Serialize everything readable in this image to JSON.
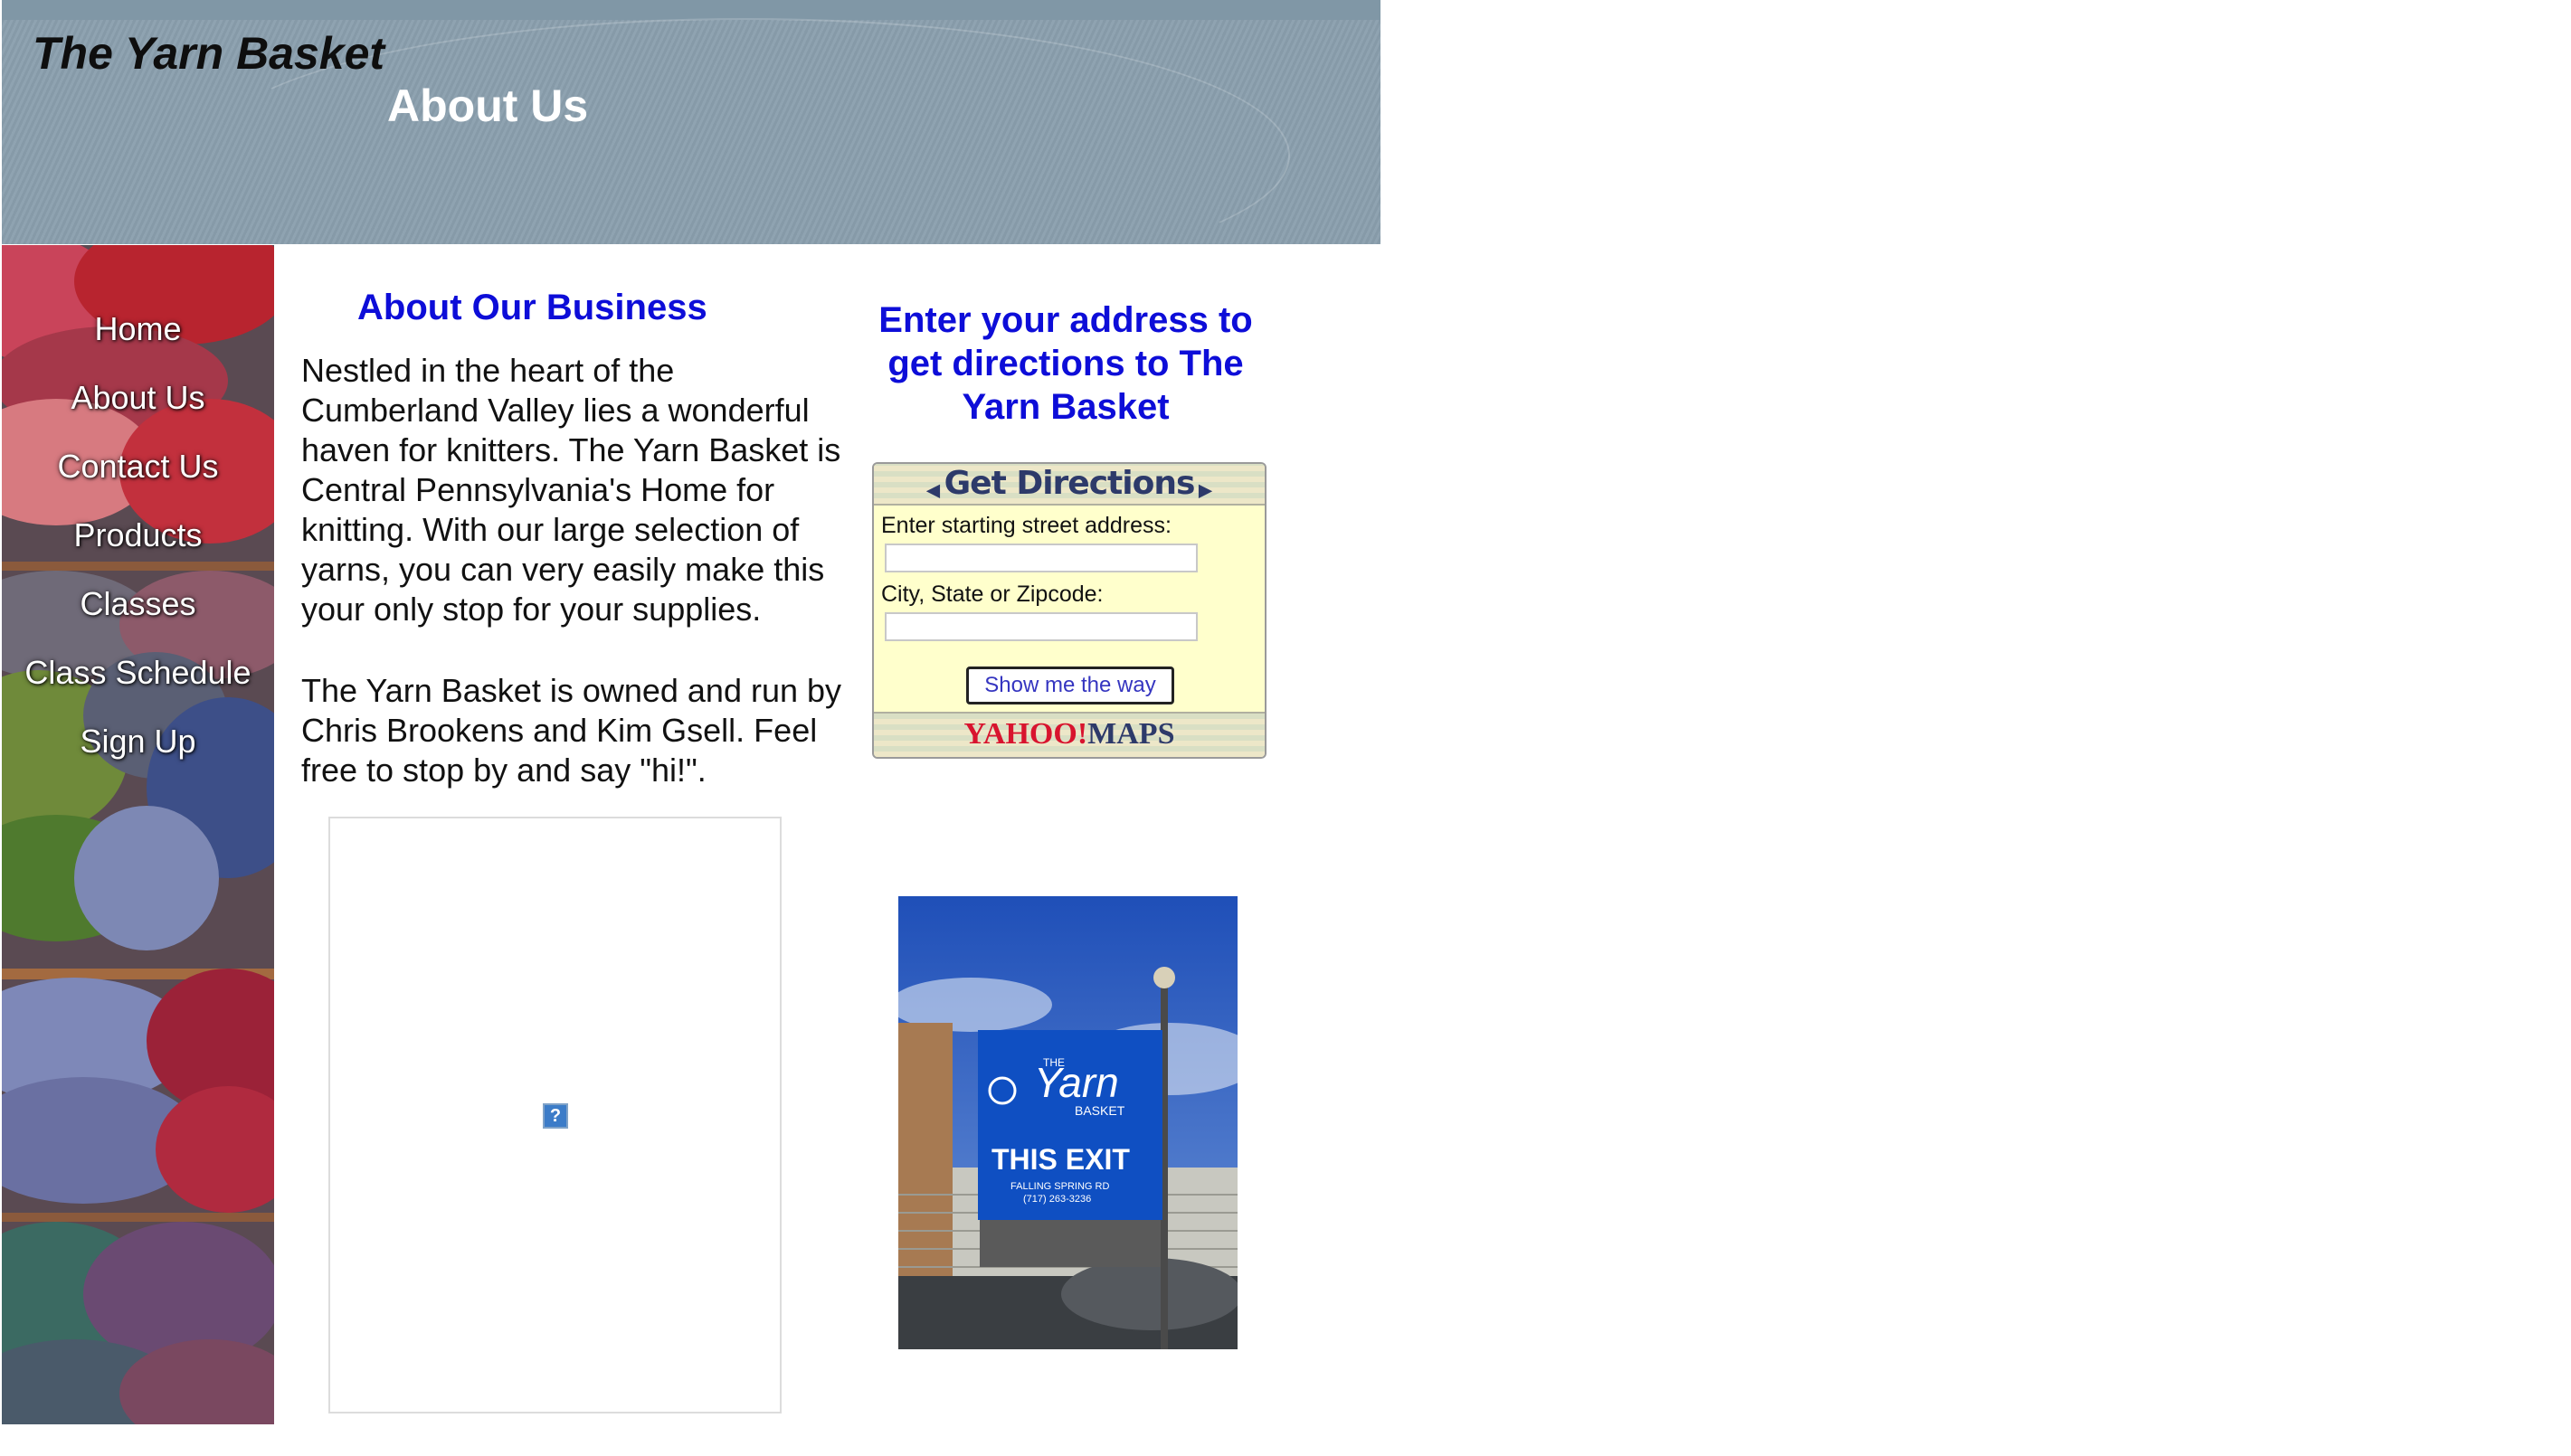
{
  "header": {
    "site_title": "The Yarn Basket",
    "page_title": "About Us"
  },
  "nav": {
    "items": [
      {
        "label": "Home"
      },
      {
        "label": "About Us"
      },
      {
        "label": "Contact Us"
      },
      {
        "label": "Products"
      },
      {
        "label": "Classes"
      },
      {
        "label": "Class Schedule"
      },
      {
        "label": "Sign Up"
      }
    ]
  },
  "main": {
    "heading": "About Our Business",
    "paragraph1": "Nestled in the heart of the Cumberland Valley lies a wonderful haven for knitters. The Yarn Basket is Central Pennsylvania's Home for knitting. With our large selection of yarns, you can very easily make this your only stop for your supplies.",
    "paragraph2": "The Yarn Basket is owned and run by Chris Brookens and Kim Gsell. Feel free to stop by and say \"hi!\".",
    "broken_image_glyph": "?"
  },
  "directions": {
    "heading": "Enter your address to get directions to The Yarn Basket",
    "widget_title": "Get Directions",
    "street_label": "Enter starting street address:",
    "street_value": "",
    "city_label": "City, State or Zipcode:",
    "city_value": "",
    "button_label": "Show me the way",
    "brand_yahoo": "YAHOO!",
    "brand_maps": "MAPS"
  },
  "photo": {
    "sign_small": "THE",
    "sign_brand": "Yarn",
    "sign_sub": "BASKET",
    "sign_exit": "THIS EXIT",
    "sign_road": "FALLING SPRING RD",
    "sign_phone": "(717) 263-3236"
  },
  "colors": {
    "heading_blue": "#0d0dd8",
    "header_slate": "#8fa3b1",
    "widget_bg": "#ffffcc"
  }
}
